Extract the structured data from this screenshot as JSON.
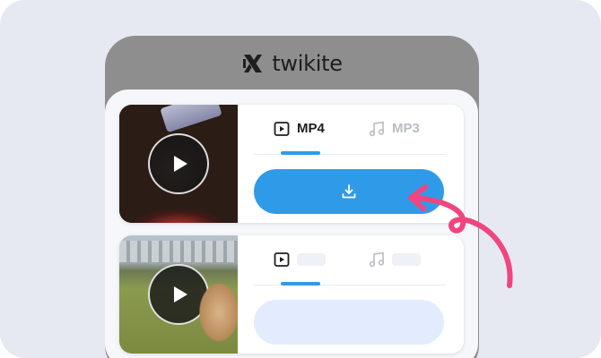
{
  "brand": {
    "name": "twikite",
    "icon": "twikite-logo-icon"
  },
  "cards": [
    {
      "thumbnail": "birthday-cake-video-thumbnail",
      "tabs": [
        {
          "label": "MP4",
          "icon": "video-play-icon",
          "active": true
        },
        {
          "label": "MP3",
          "icon": "music-note-icon",
          "active": false
        }
      ],
      "button_icon": "download-icon"
    },
    {
      "thumbnail": "dog-in-park-video-thumbnail",
      "tabs": [
        {
          "label": "",
          "icon": "video-play-icon",
          "active": true
        },
        {
          "label": "",
          "icon": "music-note-icon",
          "active": false
        }
      ],
      "button_icon": ""
    }
  ],
  "colors": {
    "accent": "#2f9be8",
    "arrow": "#f0457f",
    "backdrop": "#e6e9f1",
    "device": "#8e8e8e"
  }
}
